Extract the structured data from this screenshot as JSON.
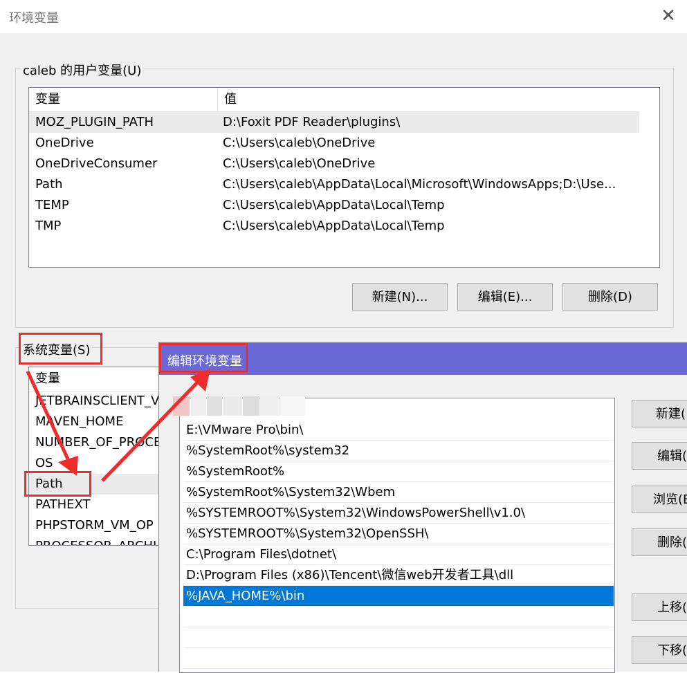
{
  "window": {
    "title": "环境变量",
    "close_glyph": "✕"
  },
  "user_vars": {
    "label": "caleb 的用户变量(U)",
    "columns": [
      "变量",
      "值"
    ],
    "rows": [
      {
        "name": "MOZ_PLUGIN_PATH",
        "value": "D:\\Foxit PDF Reader\\plugins\\"
      },
      {
        "name": "OneDrive",
        "value": "C:\\Users\\caleb\\OneDrive"
      },
      {
        "name": "OneDriveConsumer",
        "value": "C:\\Users\\caleb\\OneDrive"
      },
      {
        "name": "Path",
        "value": "C:\\Users\\caleb\\AppData\\Local\\Microsoft\\WindowsApps;D:\\Use..."
      },
      {
        "name": "TEMP",
        "value": "C:\\Users\\caleb\\AppData\\Local\\Temp"
      },
      {
        "name": "TMP",
        "value": "C:\\Users\\caleb\\AppData\\Local\\Temp"
      }
    ],
    "buttons": {
      "new": "新建(N)...",
      "edit": "编辑(E)...",
      "delete": "删除(D)"
    }
  },
  "system_vars": {
    "label": "系统变量(S)",
    "column": "变量",
    "rows": [
      "JETBRAINSCLIENT_V",
      "MAVEN_HOME",
      "NUMBER_OF_PROCE",
      "OS",
      "Path",
      "PATHEXT",
      "PHPSTORM_VM_OP",
      "PROCESSOR_ARCHI"
    ]
  },
  "edit_dialog": {
    "title": "编辑环境变量",
    "entries": [
      "E:\\VMware Pro\\bin\\",
      "%SystemRoot%\\system32",
      "%SystemRoot%",
      "%SystemRoot%\\System32\\Wbem",
      "%SYSTEMROOT%\\System32\\WindowsPowerShell\\v1.0\\",
      "%SYSTEMROOT%\\System32\\OpenSSH\\",
      "C:\\Program Files\\dotnet\\",
      "D:\\Program Files (x86)\\Tencent\\微信web开发者工具\\dll",
      "%JAVA_HOME%\\bin"
    ],
    "selected_index": 8,
    "buttons": {
      "new": "新建(",
      "edit": "编辑(",
      "browse": "浏览(B",
      "delete": "删除(",
      "move_up": "上移(",
      "move_down": "下移("
    }
  },
  "colors": {
    "dialog_title_bg": "#6b69d6",
    "selection": "#0078d7",
    "annotation_red": "#ee2c2c"
  }
}
